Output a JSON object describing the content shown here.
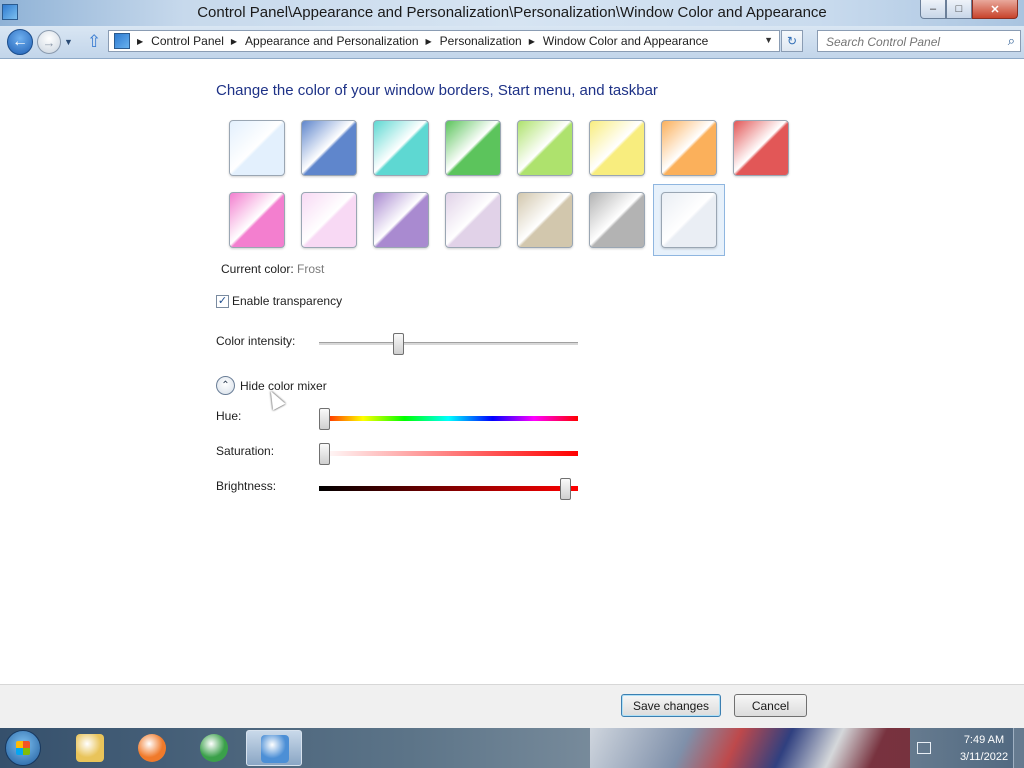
{
  "window": {
    "title": "Control Panel\\Appearance and Personalization\\Personalization\\Window Color and Appearance",
    "controls": {
      "minimize": "–",
      "maximize": "□",
      "close": "✕"
    }
  },
  "nav": {
    "back_glyph": "←",
    "forward_glyph": "→",
    "dropdown_glyph": "▼",
    "up_glyph": "⇧",
    "breadcrumbs": [
      "Control Panel",
      "Appearance and Personalization",
      "Personalization",
      "Window Color and Appearance"
    ],
    "address_dropdown_glyph": "▼",
    "refresh_glyph": "↻",
    "search_placeholder": "Search Control Panel",
    "search_glyph": "⌕"
  },
  "page": {
    "heading": "Change the color of your window borders, Start menu, and taskbar",
    "swatches": [
      {
        "name": "sky",
        "color": "#e3f0fd"
      },
      {
        "name": "twilight",
        "color": "#5f86cc"
      },
      {
        "name": "sea",
        "color": "#5ed8d2"
      },
      {
        "name": "leaf",
        "color": "#5cc45c"
      },
      {
        "name": "lime",
        "color": "#aee26d"
      },
      {
        "name": "lemon",
        "color": "#f8ed7e"
      },
      {
        "name": "pumpkin",
        "color": "#fbb05b"
      },
      {
        "name": "ruby",
        "color": "#e25757"
      },
      {
        "name": "fuchsia",
        "color": "#f37fcf"
      },
      {
        "name": "blush",
        "color": "#f8d9f4"
      },
      {
        "name": "violet",
        "color": "#a98ad0"
      },
      {
        "name": "lavender",
        "color": "#e1d2e8"
      },
      {
        "name": "taupe",
        "color": "#d2c7ad"
      },
      {
        "name": "chocolate",
        "color": "#b3b3b3"
      },
      {
        "name": "frost",
        "color": "#eaeef4"
      }
    ],
    "selected_swatch": "frost",
    "current_color_label": "Current color:",
    "current_color_value": "Frost",
    "checkbox_mark": "✓",
    "enable_transparency_label": "Enable transparency",
    "enable_transparency_checked": true,
    "color_intensity_label": "Color intensity:",
    "color_intensity_value": 0.3,
    "mixer_toggle_glyph": "⌃",
    "mixer_toggle_label": "Hide color mixer",
    "hue_label": "Hue:",
    "hue_value": 0,
    "saturation_label": "Saturation:",
    "saturation_value": 0,
    "brightness_label": "Brightness:",
    "brightness_value": 0.97
  },
  "footer": {
    "save_label": "Save changes",
    "cancel_label": "Cancel"
  },
  "taskbar": {
    "items": [
      {
        "name": "explorer",
        "color": "#e9c45a"
      },
      {
        "name": "firefox",
        "color": "#f07a2a"
      },
      {
        "name": "chrome",
        "color": "#3aa04a"
      },
      {
        "name": "control-panel",
        "color": "#4c8fd6"
      }
    ],
    "time": "7:49 AM",
    "date": "3/11/2022"
  }
}
